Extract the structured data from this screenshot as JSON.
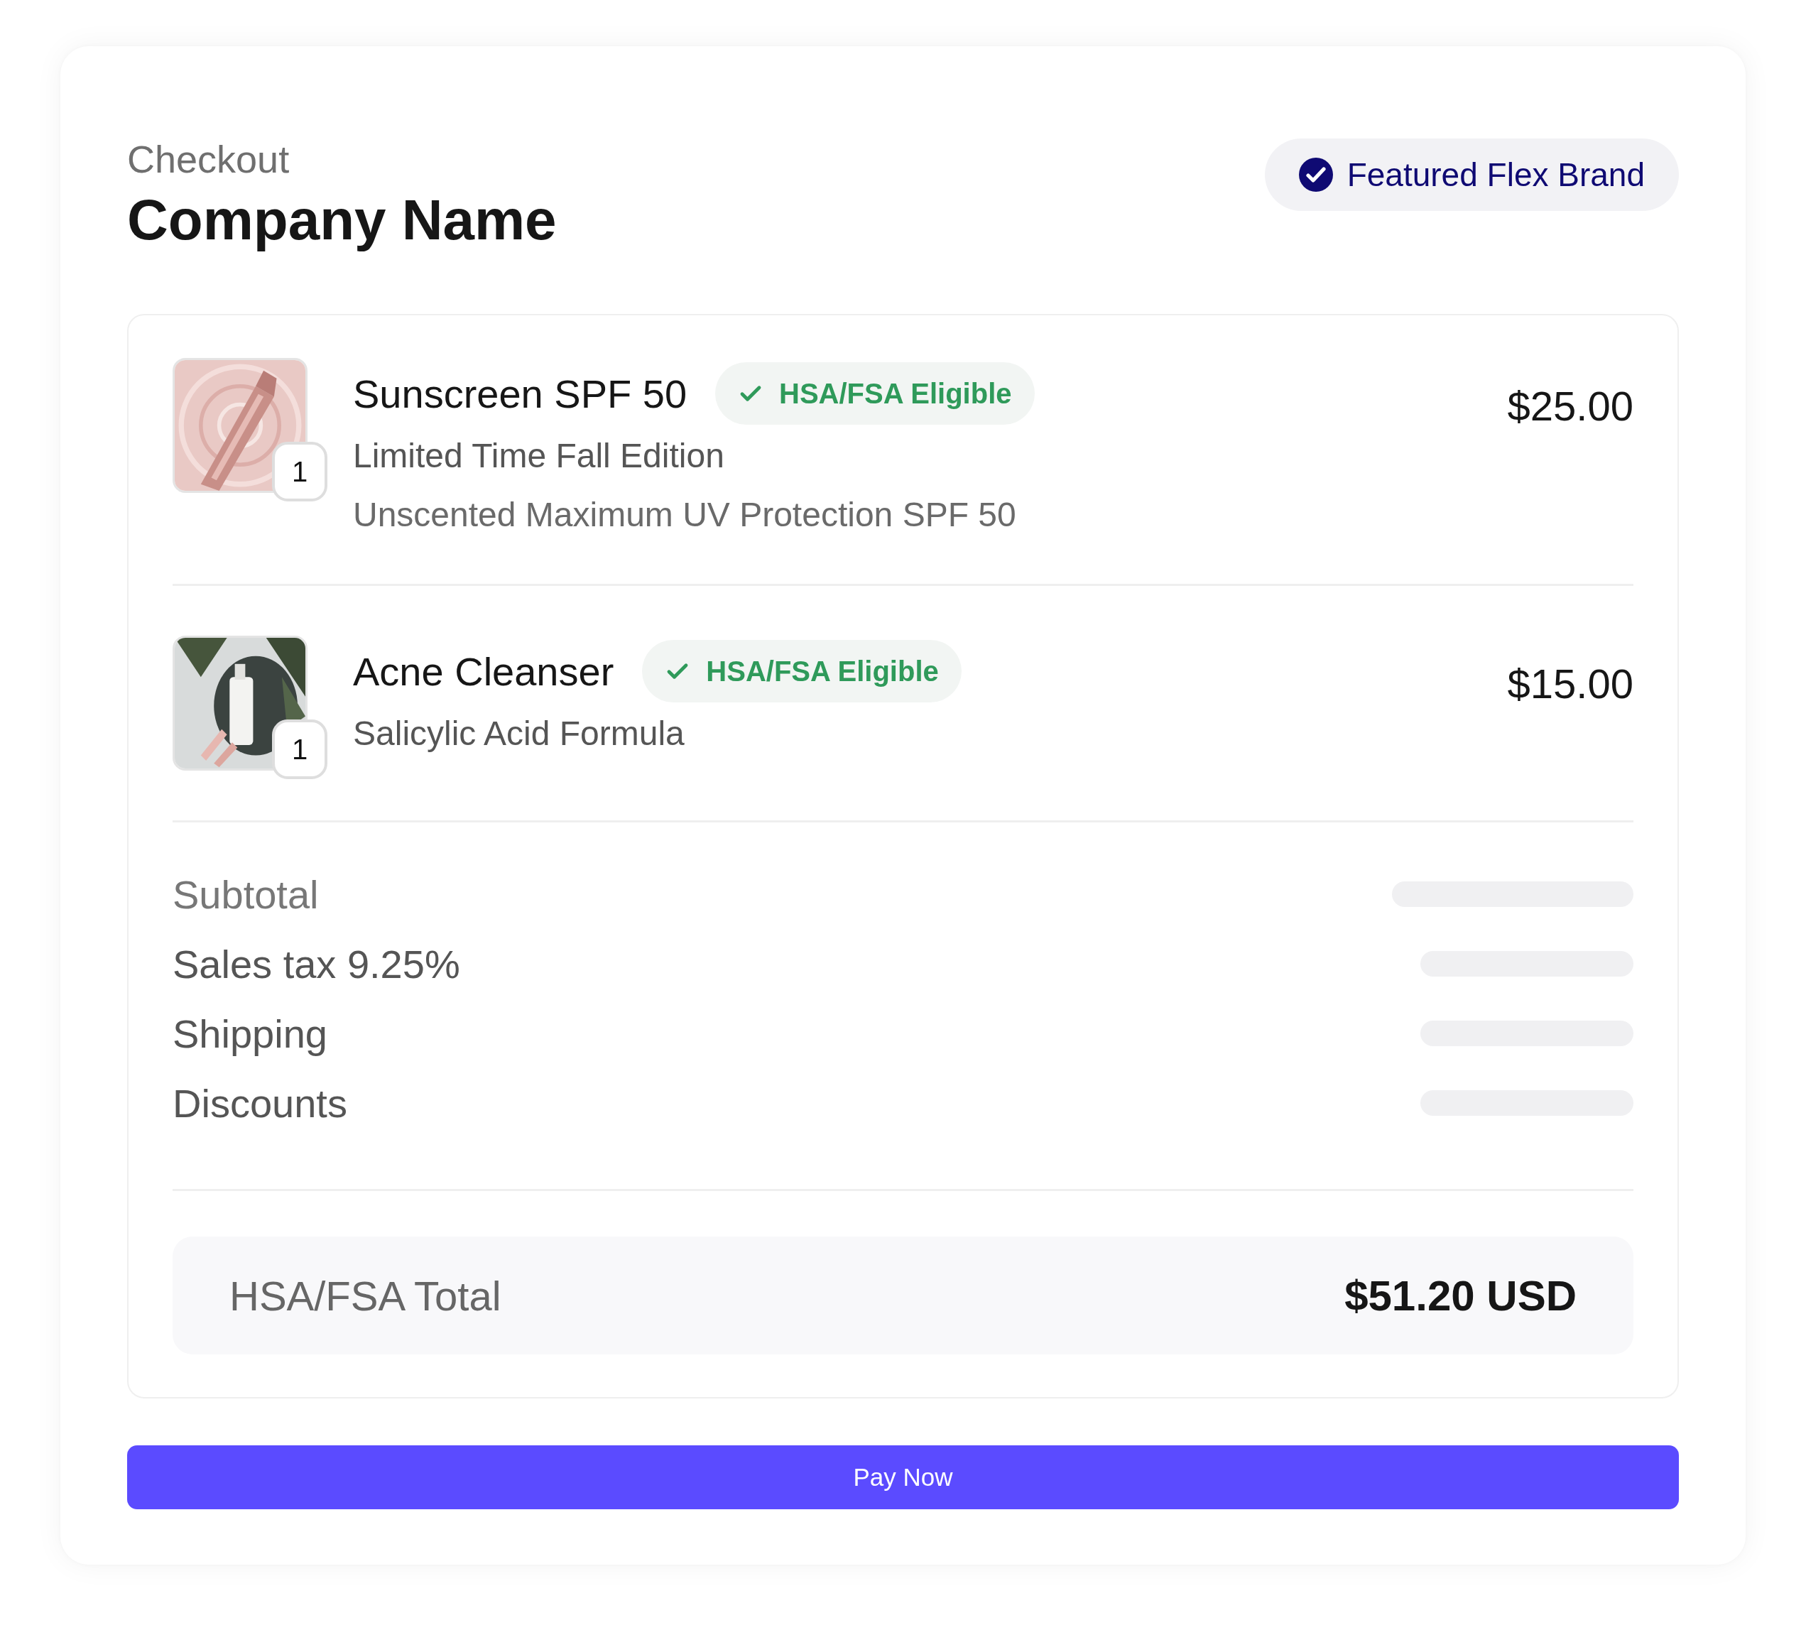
{
  "header": {
    "eyebrow": "Checkout",
    "title": "Company Name",
    "badge": {
      "label": "Featured Flex Brand"
    }
  },
  "items": [
    {
      "name": "Sunscreen SPF 50",
      "tag": "HSA/FSA Eligible",
      "lines": [
        "Limited Time Fall Edition",
        "Unscented Maximum UV Protection SPF 50"
      ],
      "price": "$25.00",
      "quantity": "1",
      "picture": {
        "kind": "picture"
      }
    },
    {
      "name": "Acne Cleanser",
      "tag": "HSA/FSA Eligible",
      "lines": [
        "Salicylic Acid Formula"
      ],
      "price": "$15.00",
      "quantity": "1",
      "picture": {
        "kind": "picture"
      }
    }
  ],
  "summary": [
    {
      "label": "Subtotal",
      "loading": true
    },
    {
      "label": "Sales tax 9.25%",
      "loading": true
    },
    {
      "label": "Shipping",
      "loading": true
    },
    {
      "label": "Discounts",
      "loading": true
    }
  ],
  "total": {
    "label": "HSA/FSA Total",
    "value": "$51.20 USD"
  },
  "pay_button": {
    "label": "Pay Now"
  }
}
